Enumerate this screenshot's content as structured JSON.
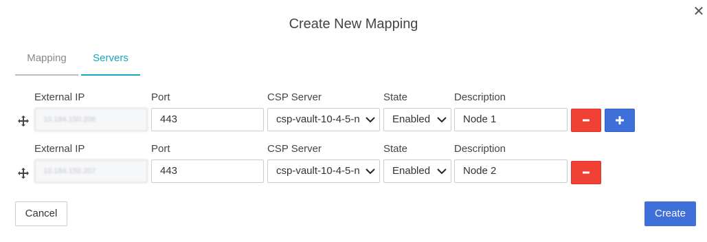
{
  "dialog": {
    "title": "Create New Mapping",
    "close_label": "✕"
  },
  "tabs": [
    {
      "label": "Mapping",
      "active": false
    },
    {
      "label": "Servers",
      "active": true
    }
  ],
  "columns": {
    "external_ip": "External IP",
    "port": "Port",
    "csp_server": "CSP Server",
    "state": "State",
    "description": "Description"
  },
  "rows": [
    {
      "external_ip": "10.184.150.206",
      "port": "443",
      "csp_server": "csp-vault-10-4-5-n",
      "state": "Enabled",
      "description": "Node 1"
    },
    {
      "external_ip": "10.184.150.207",
      "port": "443",
      "csp_server": "csp-vault-10-4-5-n",
      "state": "Enabled",
      "description": "Node 2"
    }
  ],
  "footer": {
    "cancel_label": "Cancel",
    "create_label": "Create"
  },
  "colors": {
    "accent_tab": "#17a6c0",
    "remove_button": "#f04134",
    "primary_button": "#3f6fd8"
  },
  "icons": {
    "row_handle": "move-arrows-icon",
    "remove": "minus-icon",
    "add": "plus-icon",
    "close": "close-icon",
    "select": "chevron-down-icon"
  }
}
